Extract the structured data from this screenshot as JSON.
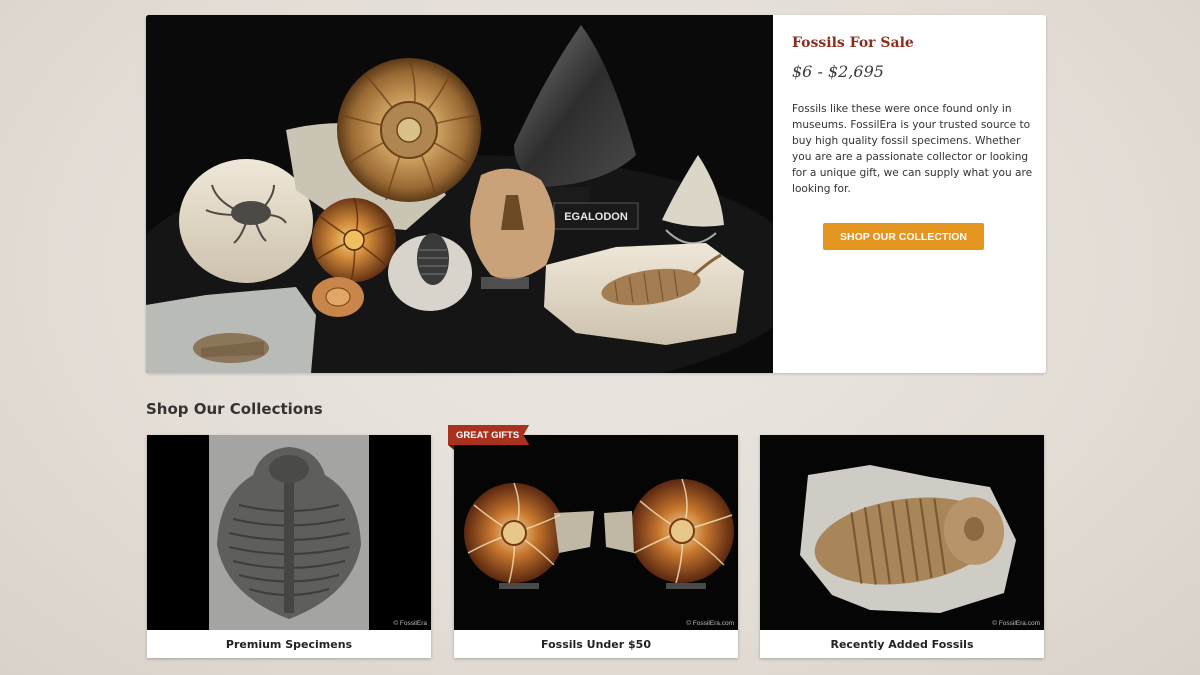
{
  "hero": {
    "title": "Fossils For Sale",
    "price_range": "$6 - $2,695",
    "description": "Fossils like these were once found only in museums. FossilEra is your trusted source to buy high quality fossil specimens. Whether you are are a passionate collector or looking for a unique gift, we can supply what you are looking for.",
    "cta_label": "SHOP OUR COLLECTION",
    "photo_sign_text": "EGALODON"
  },
  "collections": {
    "heading": "Shop Our Collections",
    "cards": [
      {
        "label": "Premium Specimens",
        "image": "trilobite-on-matrix-photo",
        "watermark": "© FossilEra"
      },
      {
        "label": "Fossils Under $50",
        "image": "ammonite-pair-photo",
        "badge": "GREAT GIFTS",
        "watermark": "© FossilEra.com"
      },
      {
        "label": "Recently Added Fossils",
        "image": "trilobite-photo",
        "watermark": "© FossilEra.com"
      }
    ]
  },
  "colors": {
    "accent_button": "#e4951f",
    "title_red": "#8a2d1e",
    "badge_red": "#a8321f",
    "page_bg": "#e6e0da"
  }
}
